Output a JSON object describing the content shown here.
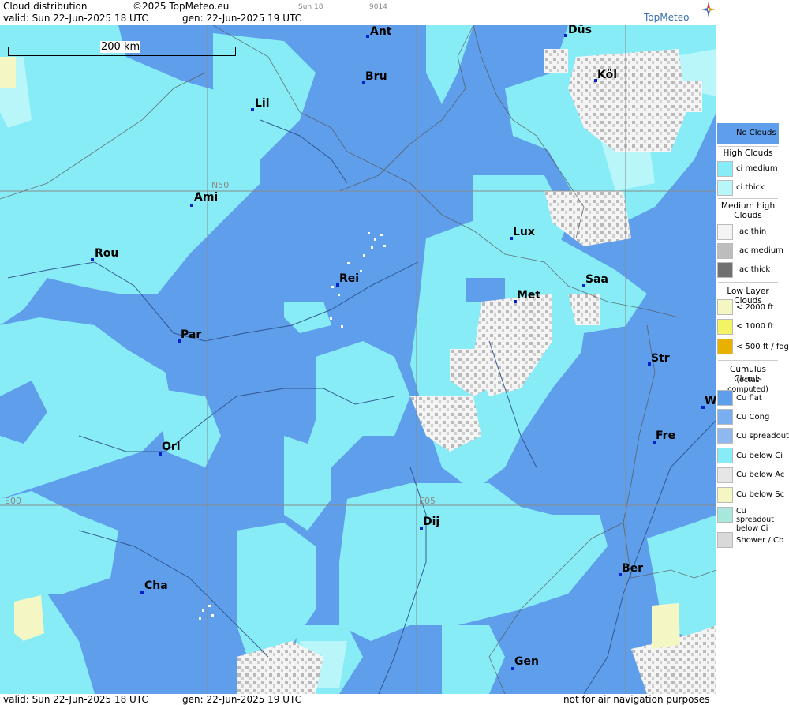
{
  "header": {
    "title": "Cloud distribution",
    "copyright": "©2025 TopMeteo.eu",
    "small_time": "Sun 18",
    "small_code": "9014",
    "valid": "valid:  Sun  22-Jun-2025  18 UTC",
    "gen": "gen:  22-Jun-2025 19 UTC",
    "brand": "TopMeteo"
  },
  "footer": {
    "valid": "valid:  Sun  22-Jun-2025  18 UTC",
    "gen": "gen:  22-Jun-2025 19 UTC",
    "note": "not for air navigation purposes"
  },
  "scale_label": "200 km",
  "grid_labels": {
    "lat": "N50",
    "lon0": "E00",
    "lon5": "E05"
  },
  "cities": {
    "ant": "Ant",
    "dus": "Düs",
    "bru": "Bru",
    "kol": "Köl",
    "lil": "Lil",
    "ami": "Ami",
    "lux": "Lux",
    "rou": "Rou",
    "rei": "Rei",
    "saa": "Saa",
    "met": "Met",
    "par": "Par",
    "str": "Str",
    "w": "W",
    "fre": "Fre",
    "orl": "Orl",
    "dij": "Dij",
    "ber": "Ber",
    "cha": "Cha",
    "gen": "Gen"
  },
  "legend": {
    "no_clouds": "No Clouds",
    "high_head": "High Clouds",
    "ci_medium": "ci medium",
    "ci_thick": "ci thick",
    "medium_head": "Medium high Clouds",
    "ac_thin": "ac thin",
    "ac_medium": "ac medium",
    "ac_thick": "ac thick",
    "low_head": "Low Layer Clouds",
    "low_2000": "< 2000 ft",
    "low_1000": "< 1000 ft",
    "low_500": "< 500 ft / fog",
    "cu_head": "Cumulus Clouds",
    "cu_sub": "(octas computed)",
    "cu_flat": "Cu flat",
    "cu_cong": "Cu Cong",
    "cu_spreadout": "Cu spreadout",
    "cu_below_ci": "Cu below Ci",
    "cu_below_ac": "Cu below Ac",
    "cu_below_sc": "Cu below Sc",
    "cu_spread_below_ci": "Cu spreadout below Ci",
    "shower": "Shower / Cb"
  },
  "colors": {
    "no_clouds": "#5f9eea",
    "ci_medium": "#87ecf6",
    "ci_thick": "#b8f6fa",
    "ac_thin": "#f4f4f4",
    "ac_medium": "#bdbdbd",
    "ac_thick": "#707070",
    "low_2000": "#f4f7c4",
    "low_1000": "#f2f463",
    "low_500": "#e8b100",
    "city_dot": "#0022cc",
    "brand": "#3a6fb0"
  }
}
